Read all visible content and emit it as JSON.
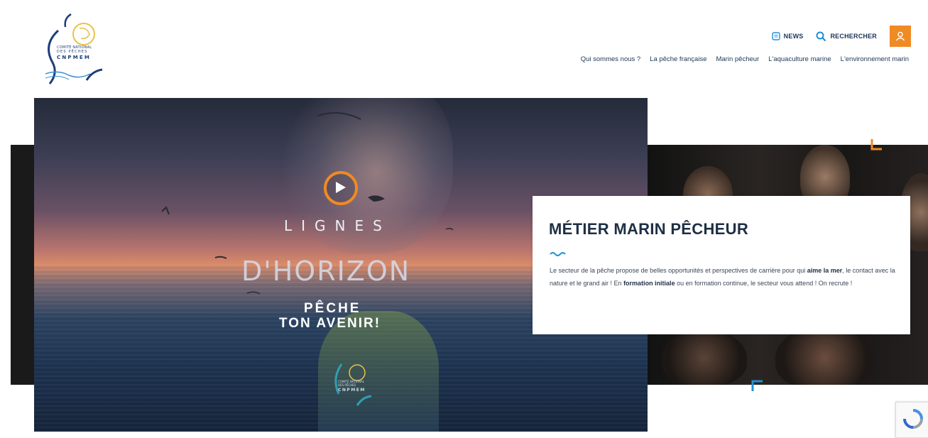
{
  "logo": {
    "line1": "COMITÉ NATIONAL",
    "line2": "DES PÊCHES",
    "line3": "CNPMEM"
  },
  "utility": {
    "news_label": "NEWS",
    "search_label": "RECHERCHER"
  },
  "nav": {
    "items": [
      {
        "label": "Qui sommes nous ?"
      },
      {
        "label": "La pêche française"
      },
      {
        "label": "Marin pêcheur"
      },
      {
        "label": "L'aquaculture marine"
      },
      {
        "label": "L'environnement marin"
      }
    ]
  },
  "video": {
    "title_line1": "LIGNES",
    "title_line2": "D'HORIZON",
    "subtitle_line1": "PÊCHE",
    "subtitle_line2": "TON AVENIR!",
    "logo_line1": "COMITÉ NATIONAL",
    "logo_line2": "DES PÊCHES",
    "logo_line3": "CNPMEM"
  },
  "card": {
    "title": "MÉTIER MARIN PÊCHEUR",
    "text_part1": "Le secteur de la pêche propose de belles opportunités et perspectives de carrière pour qui ",
    "text_bold1": "aime la mer",
    "text_part2": ", le contact avec la nature et le grand air ! En ",
    "text_bold2": "formation initiale",
    "text_part3": " ou en formation continue, le secteur vous attend ! On recrute !"
  },
  "colors": {
    "accent_orange": "#f08a24",
    "accent_blue": "#1e90d6",
    "navy": "#1d3557"
  },
  "icons": [
    "news-icon",
    "search-icon",
    "user-icon",
    "play-icon",
    "wave-icon",
    "recaptcha-icon"
  ]
}
